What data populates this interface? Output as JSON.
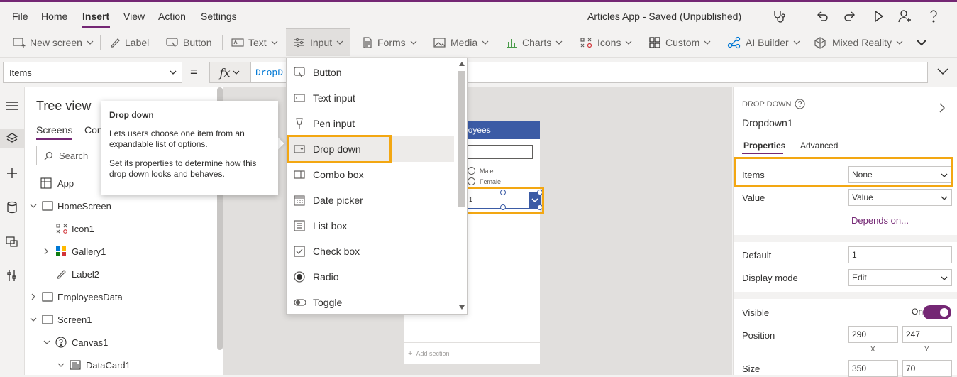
{
  "menubar": {
    "items": [
      "File",
      "Home",
      "Insert",
      "View",
      "Action",
      "Settings"
    ],
    "app_title": "Articles App - Saved (Unpublished)"
  },
  "ribbon": {
    "new_screen": "New screen",
    "label": "Label",
    "button": "Button",
    "text": "Text",
    "input": "Input",
    "forms": "Forms",
    "media": "Media",
    "charts": "Charts",
    "icons": "Icons",
    "custom": "Custom",
    "ai_builder": "AI Builder",
    "mixed_reality": "Mixed Reality"
  },
  "formula": {
    "property": "Items",
    "equals": "=",
    "fx": "fx",
    "value": "DropD"
  },
  "tree": {
    "title": "Tree view",
    "tab_screens": "Screens",
    "tab_components": "Com",
    "search_placeholder": "Search",
    "rows": [
      "App",
      "HomeScreen",
      "Icon1",
      "Gallery1",
      "Label2",
      "EmployeesData",
      "Screen1",
      "Canvas1",
      "DataCard1"
    ]
  },
  "tooltip": {
    "title": "Drop down",
    "line1": "Lets users choose one item from an expandable list of options.",
    "line2": "Set its properties to determine how this drop down looks and behaves."
  },
  "input_menu": {
    "items": [
      "Button",
      "Text input",
      "Pen input",
      "Drop down",
      "Combo box",
      "Date picker",
      "List box",
      "Check box",
      "Radio",
      "Toggle"
    ],
    "selected": "Drop down"
  },
  "canvas": {
    "header": "loyees",
    "radio1": "Male",
    "radio2": "Female",
    "dd_value": "1",
    "add_section": "Add section"
  },
  "properties": {
    "type": "DROP DOWN",
    "name": "Dropdown1",
    "tab_properties": "Properties",
    "tab_advanced": "Advanced",
    "items_label": "Items",
    "items_value": "None",
    "value_label": "Value",
    "value_value": "Value",
    "depends_on": "Depends on...",
    "default_label": "Default",
    "default_value": "1",
    "display_mode_label": "Display mode",
    "display_mode_value": "Edit",
    "visible_label": "Visible",
    "visible_value": "On",
    "position_label": "Position",
    "position_x": "290",
    "position_y": "247",
    "x_label": "X",
    "y_label": "Y",
    "size_label": "Size",
    "size_w": "350",
    "size_h": "70"
  },
  "colors": {
    "accent": "#742774",
    "highlight": "#f3a712",
    "screen_header": "#3b5ba5"
  }
}
